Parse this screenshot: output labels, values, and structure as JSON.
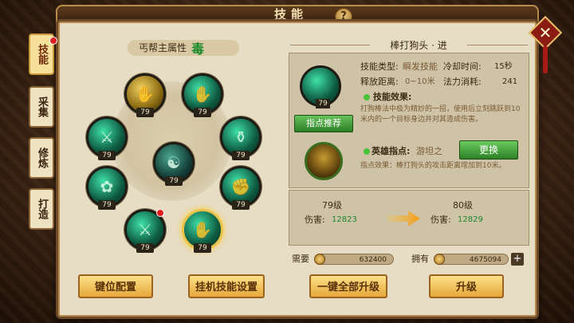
{
  "header": {
    "title": "技能",
    "help_label": "?"
  },
  "close_label": "✕",
  "tabs": [
    {
      "label": "技能",
      "active": true
    },
    {
      "label": "采集"
    },
    {
      "label": "修炼"
    },
    {
      "label": "打造"
    }
  ],
  "left": {
    "attribute_label": "丐帮主属性",
    "attribute_value": "毒",
    "skills": [
      {
        "level": "79"
      },
      {
        "level": "79"
      },
      {
        "level": "79"
      },
      {
        "level": "79"
      },
      {
        "level": "79"
      },
      {
        "level": "79"
      },
      {
        "level": "79"
      },
      {
        "level": "79"
      },
      {
        "level": "79"
      },
      {
        "level": "79"
      }
    ],
    "buttons": {
      "keybind": "键位配置",
      "auto_skill": "挂机技能设置"
    }
  },
  "right": {
    "skill_name": "棒打狗头 · 进",
    "skill_level": "79",
    "recommend_button": "指点推荐",
    "type_label": "技能类型:",
    "type_value": "瞬发技能",
    "cooldown_label": "冷却时间:",
    "cooldown_value": "15秒",
    "range_label": "释放距离:",
    "range_value": "0~10米",
    "mana_label": "法力消耗:",
    "mana_value": "241",
    "effect_title": "技能效果:",
    "effect_desc": "打狗棒法中极为精妙的一招，使用后立刻跳跃到10米内的一个目标身边并对其造成伤害。",
    "hero_label": "英雄指点:",
    "hero_name": "游坦之",
    "swap_button": "更换",
    "hero_desc": "指点效果：棒打狗头的攻击距离增加到10米。",
    "current_level": "79级",
    "next_level": "80级",
    "damage_label": "伤害:",
    "current_damage": "12823",
    "next_damage": "12829",
    "need_label": "需要",
    "need_value": "632400",
    "have_label": "拥有",
    "have_value": "4675094",
    "plus_label": "+",
    "upgrade_all_button": "一键全部升级",
    "upgrade_button": "升级"
  },
  "colors": {
    "accent_green": "#49c23a",
    "value_green": "#1a8a2a",
    "button_gold": "#e5a83a"
  }
}
